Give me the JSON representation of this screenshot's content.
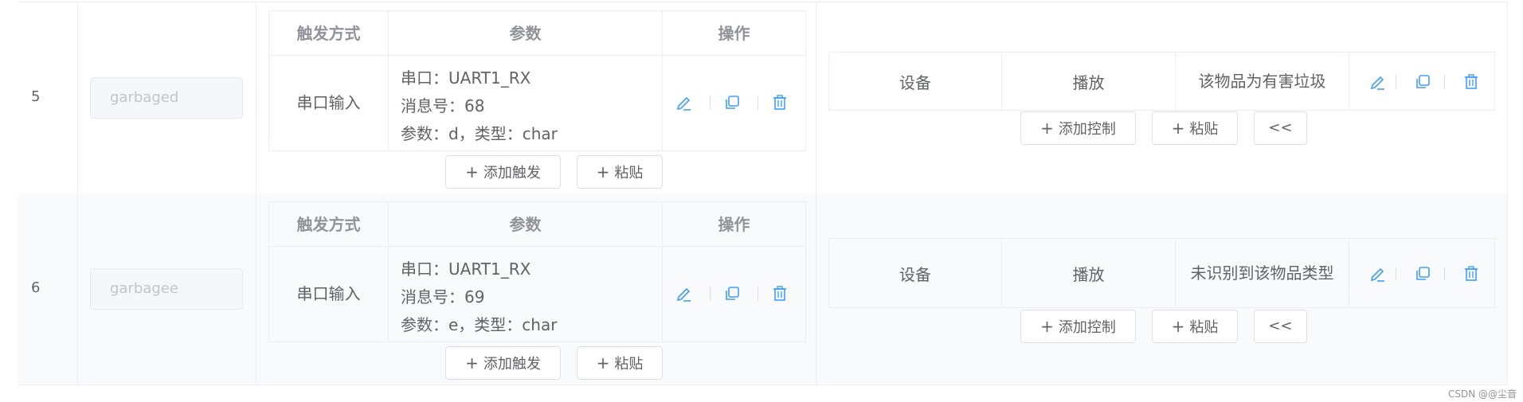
{
  "rows": [
    {
      "index": "5",
      "name_value": "garbaged",
      "trigger": {
        "headers": [
          "触发方式",
          "参数",
          "操作"
        ],
        "type": "串口输入",
        "params": [
          "串口：UART1_RX",
          "消息号：68",
          "参数：d，类型：char"
        ]
      },
      "buttons": {
        "add_trigger": "添加触发",
        "paste": "粘贴"
      },
      "control": {
        "device": "设备",
        "action": "播放",
        "content": "该物品为有害垃圾"
      },
      "control_buttons": {
        "add_control": "添加控制",
        "paste": "粘贴",
        "collapse": "<<"
      }
    },
    {
      "index": "6",
      "name_value": "garbagee",
      "trigger": {
        "headers": [
          "触发方式",
          "参数",
          "操作"
        ],
        "type": "串口输入",
        "params": [
          "串口：UART1_RX",
          "消息号：69",
          "参数：e，类型：char"
        ]
      },
      "buttons": {
        "add_trigger": "添加触发",
        "paste": "粘贴"
      },
      "control": {
        "device": "设备",
        "action": "播放",
        "content": "未识别到该物品类型"
      },
      "control_buttons": {
        "add_control": "添加控制",
        "paste": "粘贴",
        "collapse": "<<"
      }
    }
  ],
  "icons": [
    "edit-icon",
    "copy-icon",
    "delete-icon"
  ],
  "colors": {
    "icon": "#409eff",
    "border": "#ebeef5",
    "alt_row_bg": "#f9fafc"
  },
  "watermark": "CSDN @@尘音"
}
